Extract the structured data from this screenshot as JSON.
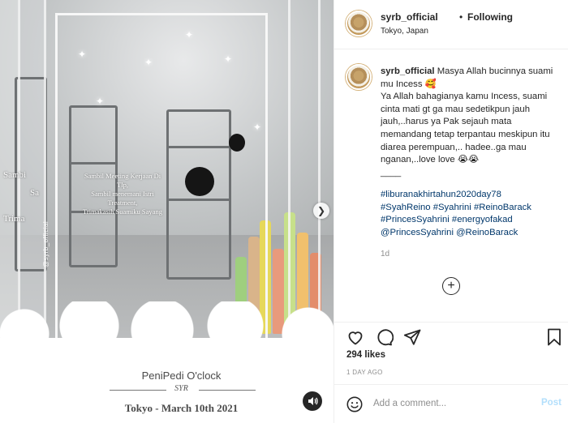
{
  "post": {
    "username": "syrb_official",
    "follow_separator": "•",
    "follow_status": "Following",
    "location": "Tokyo, Japan"
  },
  "media": {
    "overlay_lines": [
      "Sambil Meeting Kerjaan Di",
      "Tlp,",
      "Sambil menemani Istri",
      "Treatment,",
      "Trimakasih Suamiku Sayang"
    ],
    "ghost_text_1": "Sambi",
    "ghost_text_2": "Sa",
    "ghost_text_3": "Trima",
    "watermark": "@syrb_official",
    "caption_title": "PeniPedi O'clock",
    "caption_signature": "SYR",
    "caption_date": "Tokyo - March 10th 2021",
    "next_icon": "chevron-right-icon",
    "sound_icon": "speaker-mute-icon"
  },
  "caption": {
    "username": "syrb_official",
    "text_lines": [
      "Masya Allah bucinnya suami mu Incess 🥰",
      "Ya Allah bahagianya kamu Incess, suami cinta mati gt ga mau sedetikpun jauh jauh,..harus ya Pak sejauh mata memandang tetap terpantau meskipun itu diarea perempuan,.. hadee..ga mau nganan,..love love 😭😭",
      "____"
    ],
    "hashtags": [
      "#liburanakhirtahun2020day78",
      "#SyahReino",
      "#Syahrini",
      "#ReinoBarack",
      "#PrincesSyahrini",
      "#energyofakad",
      "@PrincesSyahrini",
      "@ReinoBarack"
    ],
    "age": "1d"
  },
  "actions": {
    "like_icon": "heart-icon",
    "comment_icon": "comment-icon",
    "share_icon": "share-icon",
    "save_icon": "bookmark-icon",
    "load_more_icon": "plus-circle-icon"
  },
  "stats": {
    "likes": "294 likes",
    "posted": "1 DAY AGO"
  },
  "comment_box": {
    "emoji_icon": "smiley-icon",
    "placeholder": "Add a comment...",
    "post_label": "Post"
  },
  "colors": {
    "text": "#262626",
    "link": "#00376b",
    "muted": "#8e8e8e",
    "post_disabled": "#b2dffc",
    "divider": "#efefef"
  }
}
